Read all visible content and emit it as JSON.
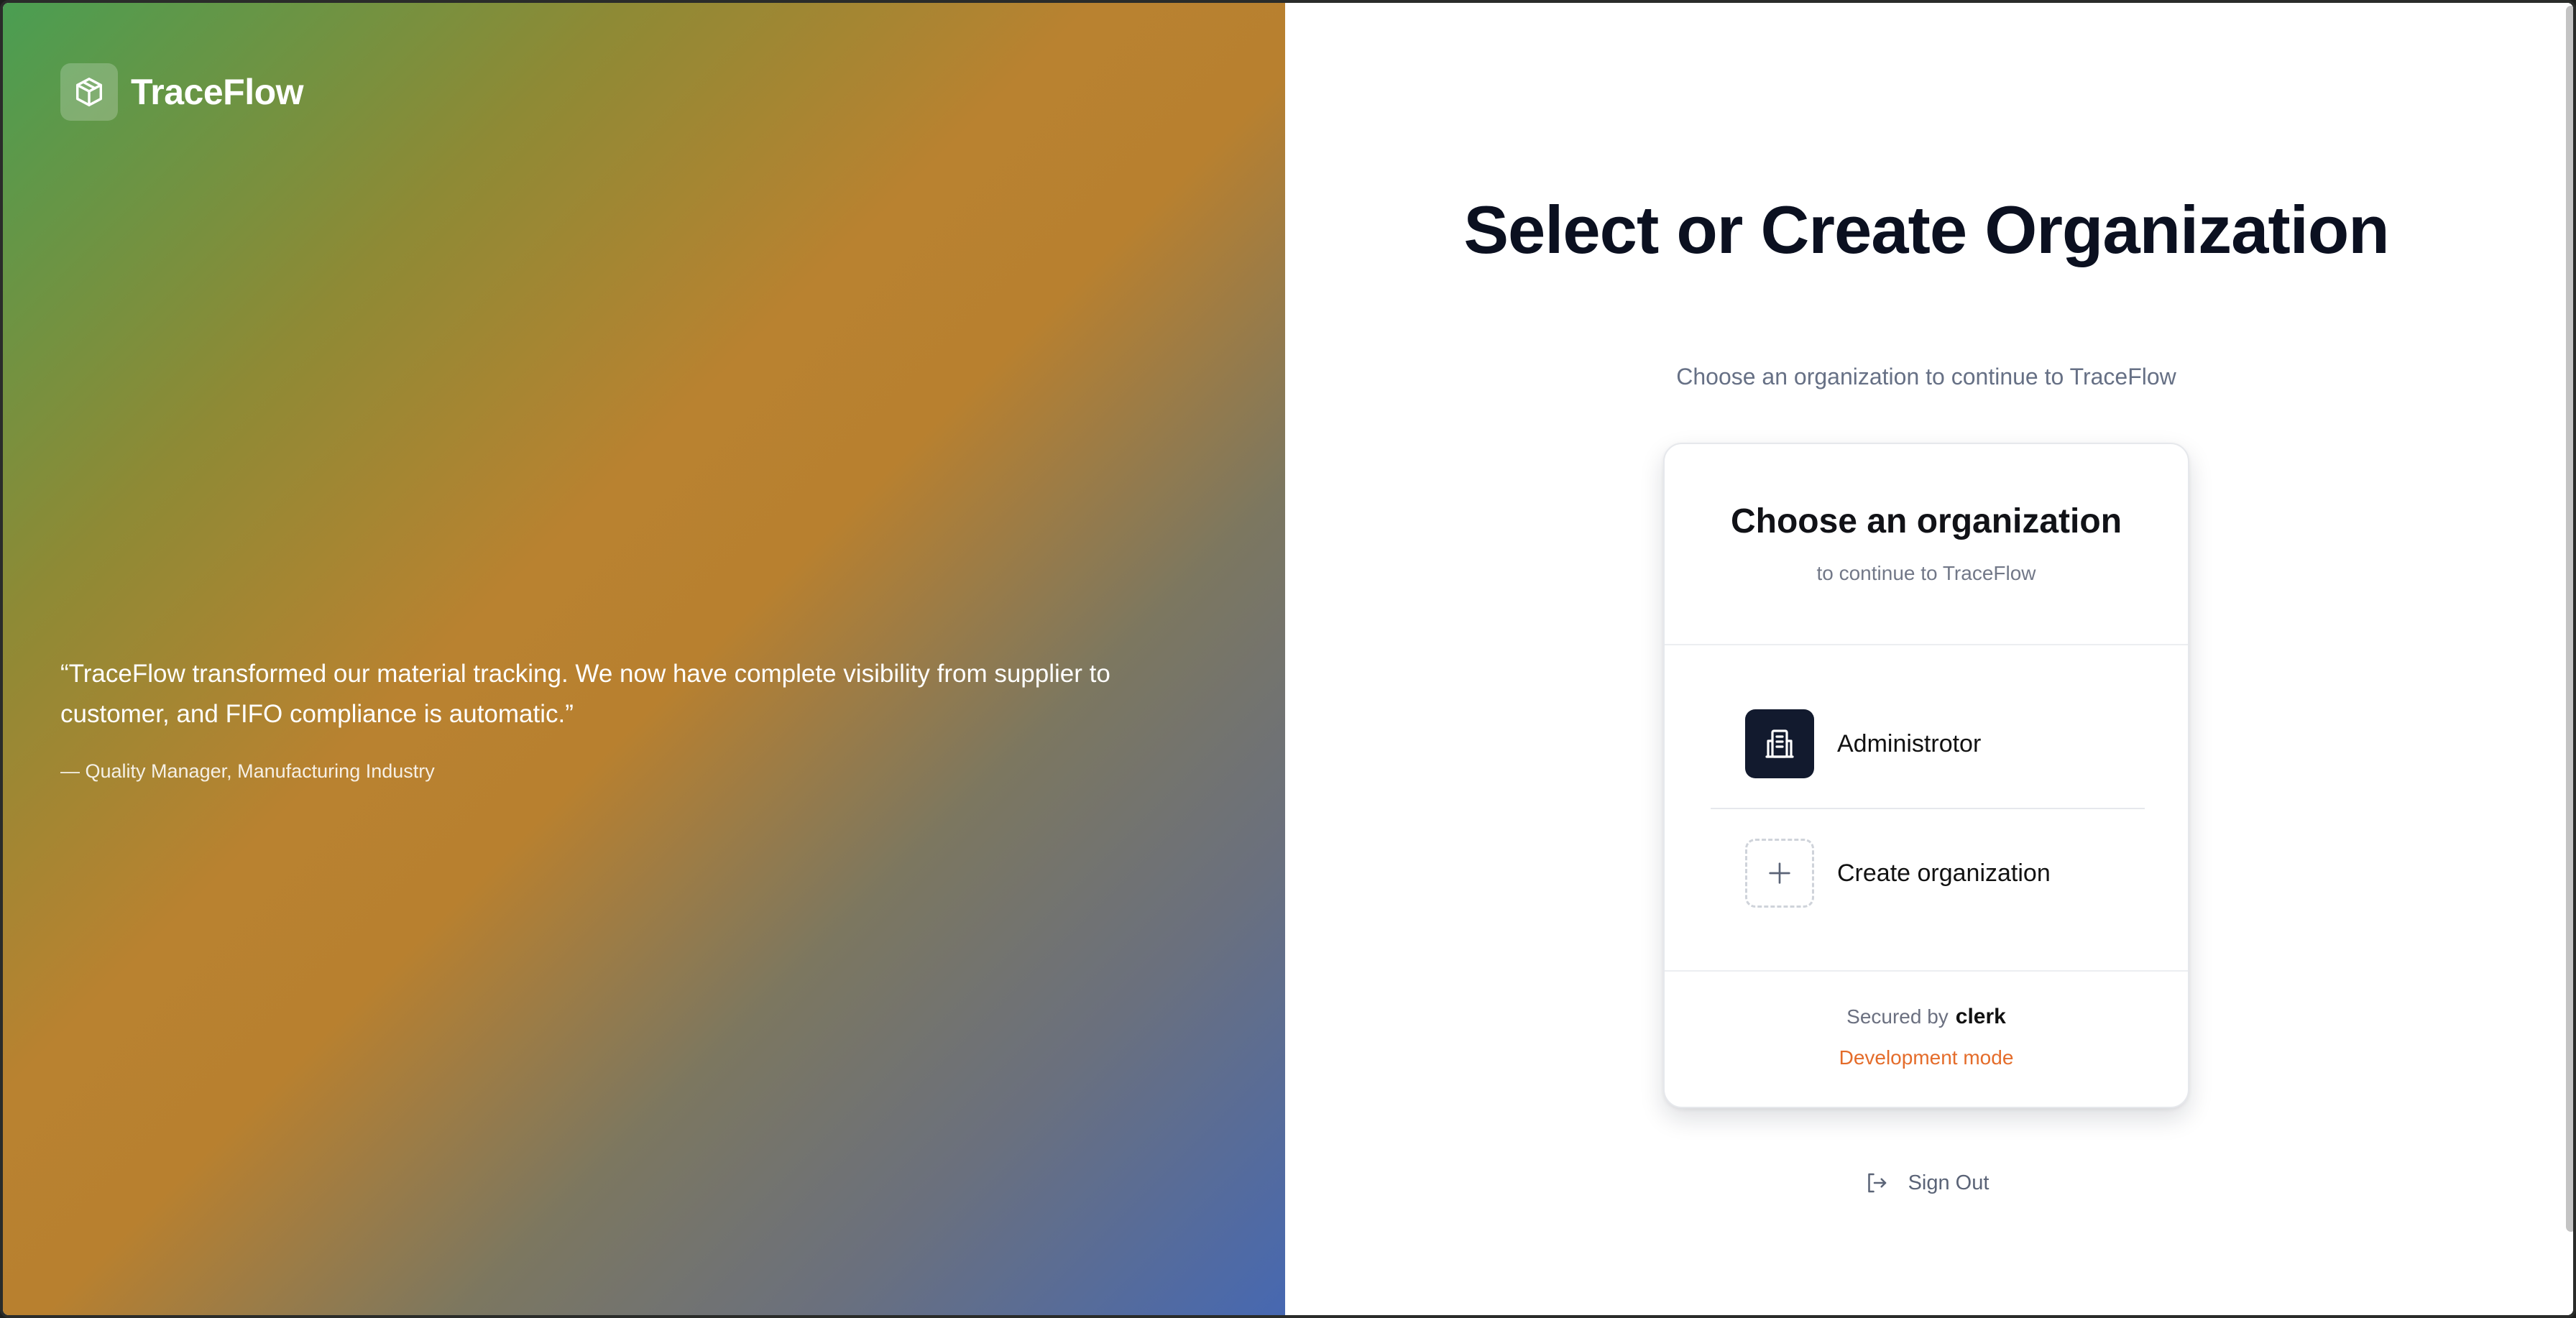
{
  "app": {
    "name": "TraceFlow"
  },
  "left_panel": {
    "quote": "“TraceFlow transformed our material tracking. We now have complete visibility from supplier to customer, and FIFO compliance is automatic.”",
    "author": "— Quality Manager, Manufacturing Industry",
    "gradient_colors": [
      "#4a9e52",
      "#b98230",
      "#4668b2"
    ],
    "logo_icon": "cube-icon"
  },
  "main": {
    "title": "Select or Create Organization",
    "subtitle": "Choose an organization to continue to TraceFlow"
  },
  "card": {
    "title": "Choose an organization",
    "subtitle": "to continue to TraceFlow",
    "organizations": [
      {
        "label": "Administrotor",
        "icon": "building-icon"
      }
    ],
    "create_label": "Create organization",
    "create_icon": "plus-icon",
    "secured_by": "Secured by",
    "secured_brand": "clerk",
    "dev_mode": "Development mode"
  },
  "sign_out": {
    "label": "Sign Out",
    "icon": "sign-out-icon"
  },
  "colors": {
    "accent_dark": "#121a2e",
    "dev_mode": "#e46c2a",
    "text_muted": "#667085"
  }
}
